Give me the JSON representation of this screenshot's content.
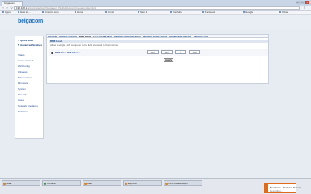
{
  "browser": {
    "tabs": [
      "belgacom",
      "",
      "",
      ""
    ],
    "window_buttons": [
      "—",
      "□",
      "×"
    ],
    "address": {
      "host": "192.168.1.1",
      "path": "/cgi-bin/webcm?getpage=../html/defs/app.htm&var:mode=dmz"
    },
    "bookmarks": [
      "Apps",
      "How to ...",
      "Amazon.com",
      "Home",
      "Gmail",
      "Sign in",
      "YouTube",
      "Facebook",
      "Google",
      "Other"
    ]
  },
  "page": {
    "logo": "belgacom",
    "sidebar": {
      "quick_start": "Quick Start",
      "advanced_settings": "Advanced Settings",
      "items": [
        "Status",
        "Home network",
        "LAN config",
        "Wireless",
        "Maintenance",
        "Firmware",
        "System",
        "Firewall",
        "Users",
        "Network interfaces",
        "Statistics"
      ]
    },
    "tabs": [
      "General",
      "Access Control",
      "DMZ Host",
      "Port Forwarding",
      "Remote Administration",
      "Website Restrictions",
      "Advanced Filtering",
      "Security Log"
    ],
    "section_title": "DMZ Host",
    "description": "Allow a single LAN computer to be fully exposed to the Internet.",
    "dmz_label": "DMZ Host IP Address:",
    "ip": [
      "192",
      "168",
      "1",
      "100"
    ],
    "apply_label": "Apply"
  },
  "taskbar": {
    "items": [
      "Start",
      "Chrome",
      "Mail",
      "Explorer",
      "VLC media player"
    ],
    "notification": {
      "title": "Broadcast - Webcam Record",
      "subtitle": "Recording..."
    }
  }
}
